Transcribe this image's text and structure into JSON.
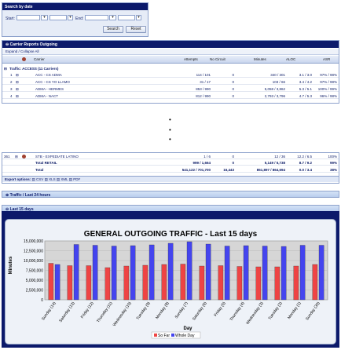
{
  "search": {
    "title": "Search by date",
    "start_label": "Start:",
    "end_label": "End:",
    "search_button": "Search",
    "reset_button": "Reset"
  },
  "report": {
    "title": "Carrier Reports Outgoing",
    "expand_collapse": "Expand / Collapse All",
    "columns": [
      "Carrier",
      "Attempts",
      "No Circuit",
      "Minutes",
      "ALOC",
      "ASR"
    ],
    "group_label": "Traffic: ACCESS (11 Carriers)",
    "rows": [
      {
        "num": "1",
        "carrier": "ACC - CS ADMA",
        "attempts": "114 / 101",
        "no_circuit": "0",
        "minutes": "340 / 301",
        "aloc": "3.1 / 3.0",
        "asr": "97% / 98%"
      },
      {
        "num": "2",
        "carrier": "ACC - CS YO LLAMO",
        "attempts": "31 / 17",
        "no_circuit": "0",
        "minutes": "103 / 66",
        "aloc": "3.4 / 4.2",
        "asr": "97% / 98%"
      },
      {
        "num": "3",
        "carrier": "ADMA - HERMES",
        "attempts": "853 / 990",
        "no_circuit": "0",
        "minutes": "5,058 / 3,862",
        "aloc": "5.3 / 5.1",
        "asr": "100% / 99%"
      },
      {
        "num": "4",
        "carrier": "ADMA - NACT",
        "attempts": "812 / 990",
        "no_circuit": "0",
        "minutes": "2,793 / 3,796",
        "aloc": "4.7 / 5.3",
        "asr": "96% / 98%"
      }
    ]
  },
  "totals": {
    "row_num": "361",
    "carrier": "STB - EXPEDIATE LATINO",
    "carrier_attempts": "1 / 6",
    "carrier_no_circuit": "0",
    "carrier_minutes": "12 / 36",
    "carrier_aloc": "12.2 / 6.5",
    "carrier_asr": "100%",
    "retail_label": "Total RETAIL",
    "retail_attempts": "999 / 1,664",
    "retail_no_circuit": "0",
    "retail_minutes": "5,149 / 5,738",
    "retail_aloc": "8.7 / 9.2",
    "retail_asr": "99%",
    "total_label": "Total",
    "total_attempts": "541,122 / 701,700",
    "total_no_circuit": "16,443",
    "total_minutes": "851,897 / 864,694",
    "total_aloc": "0.0 / 3.4",
    "total_asr": "38%",
    "export_label": "Export options:",
    "export_csv": "CSV",
    "export_xls": "XLS",
    "export_xml": "XML",
    "export_pdf": "PDF"
  },
  "sections": {
    "traffic_24h": "Traffic / Last 24 hours",
    "last_15": "Last 15 days"
  },
  "chart_data": {
    "type": "bar",
    "title": "GENERAL OUTGOING TRAFFIC - Last 15 days",
    "xlabel": "Day",
    "ylabel": "Minutes",
    "ylim": [
      0,
      15000000
    ],
    "yticks": [
      "0",
      "2,500,000",
      "5,000,000",
      "7,500,000",
      "10,000,000",
      "12,500,000",
      "15,000,000"
    ],
    "categories": [
      "Sunday (14)",
      "Saturday (13)",
      "Friday (12)",
      "Thursday (11)",
      "Wednesday (10)",
      "Tuesday (9)",
      "Monday (8)",
      "Sunday (7)",
      "Saturday (6)",
      "Friday (5)",
      "Thursday (4)",
      "Wednesday (3)",
      "Tuesday (2)",
      "Monday (1)",
      "Sunday (30)"
    ],
    "series": [
      {
        "name": "So Far",
        "color": "#ee4444",
        "values": [
          9300000,
          8700000,
          8700000,
          8200000,
          8600000,
          8800000,
          9000000,
          9100000,
          8600000,
          8700000,
          8500000,
          8400000,
          8400000,
          8600000,
          9000000
        ]
      },
      {
        "name": "Whole Day",
        "color": "#4444ee",
        "values": [
          9000000,
          14100000,
          13900000,
          13700000,
          13800000,
          14000000,
          14400000,
          14800000,
          14200000,
          13700000,
          13800000,
          13700000,
          13600000,
          13900000,
          13900000
        ]
      }
    ],
    "grid": true,
    "legend": "bottom"
  }
}
